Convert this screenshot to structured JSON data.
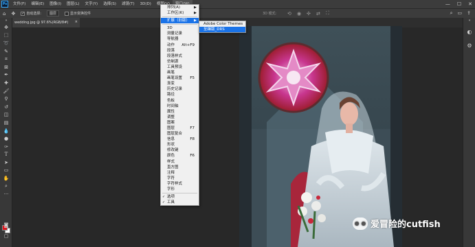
{
  "app": {
    "logo": "Ps"
  },
  "menubar": {
    "items": [
      "文件(F)",
      "编辑(E)",
      "图像(I)",
      "图层(L)",
      "文字(Y)",
      "选择(S)",
      "滤镜(T)",
      "3D(D)",
      "视图(V)",
      "窗口(W)"
    ],
    "active_index": 9
  },
  "optionsbar": {
    "auto_select_label": "自动选择:",
    "auto_select_target": "图层",
    "show_transform_label": "显示变换控件",
    "mode_label": "3D 模式:"
  },
  "document_tab": {
    "title": "wedding.jpg @ 97.6%(RGB/8#)"
  },
  "window_menu": {
    "items": [
      {
        "label": "排列(A)",
        "submenu": true
      },
      {
        "label": "工作区(K)",
        "submenu": true
      },
      {
        "sep": true
      },
      {
        "label": "扩展（旧版）",
        "submenu": true,
        "highlight": true
      },
      {
        "sep": true
      },
      {
        "label": "3D"
      },
      {
        "label": "测量记录"
      },
      {
        "label": "导航器"
      },
      {
        "label": "动作",
        "shortcut": "Alt+F9"
      },
      {
        "label": "段落"
      },
      {
        "label": "段落样式"
      },
      {
        "label": "仿制源"
      },
      {
        "label": "工具预设"
      },
      {
        "label": "画笔"
      },
      {
        "label": "画笔设置",
        "shortcut": "F5"
      },
      {
        "label": "渐变"
      },
      {
        "label": "历史记录"
      },
      {
        "label": "路径"
      },
      {
        "label": "色板"
      },
      {
        "label": "时间轴"
      },
      {
        "label": "属性"
      },
      {
        "label": "调整"
      },
      {
        "label": "图案"
      },
      {
        "label": "图层",
        "shortcut": "F7"
      },
      {
        "label": "图层复合"
      },
      {
        "label": "信息",
        "shortcut": "F8"
      },
      {
        "label": "形状"
      },
      {
        "label": "修改键"
      },
      {
        "label": "颜色",
        "shortcut": "F6"
      },
      {
        "label": "样式"
      },
      {
        "label": "直方图"
      },
      {
        "label": "注释"
      },
      {
        "label": "字符"
      },
      {
        "label": "字符样式"
      },
      {
        "label": "字形"
      },
      {
        "sep": true
      },
      {
        "label": "选项",
        "checked": true
      },
      {
        "label": "工具",
        "checked": true
      }
    ]
  },
  "extensions_submenu": {
    "items": [
      {
        "label": "Adobe Color Themes"
      },
      {
        "label": "至臻版_DRS",
        "highlight": true
      }
    ]
  },
  "watermark": {
    "text": "爱冒险的cutfish"
  },
  "colors": {
    "foreground": "#e0141c",
    "background": "#ffffff",
    "menu_highlight": "#1a73e8"
  }
}
